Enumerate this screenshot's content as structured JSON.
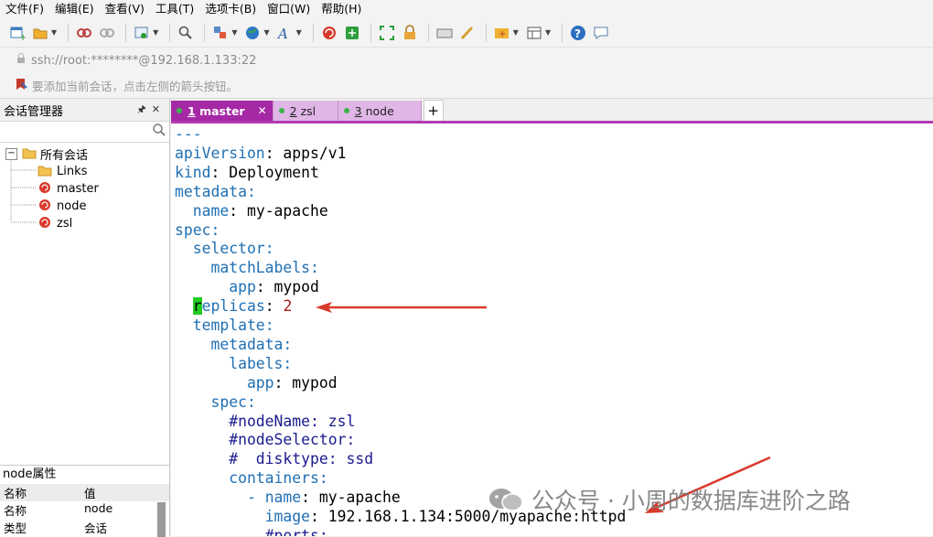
{
  "menu": [
    "文件(F)",
    "编辑(E)",
    "查看(V)",
    "工具(T)",
    "选项卡(B)",
    "窗口(W)",
    "帮助(H)"
  ],
  "address": {
    "text": "ssh://root:********@192.168.1.133:22"
  },
  "hint": {
    "text": "要添加当前会话，点击左侧的箭头按钮。"
  },
  "session_manager": {
    "title": "会话管理器",
    "root": "所有会话",
    "items": [
      "Links",
      "master",
      "node",
      "zsl"
    ]
  },
  "properties": {
    "title": "node属性",
    "headers": [
      "名称",
      "值"
    ],
    "rows": [
      [
        "名称",
        "node"
      ],
      [
        "类型",
        "会话"
      ]
    ]
  },
  "tabs": [
    {
      "num": "1",
      "label": "master",
      "active": true
    },
    {
      "num": "2",
      "label": "zsl",
      "active": false
    },
    {
      "num": "3",
      "label": "node",
      "active": false
    }
  ],
  "terminal": {
    "lines": [
      [
        [
          "---",
          "k"
        ]
      ],
      [
        [
          "apiVersion",
          "k"
        ],
        [
          ": apps/v1",
          "v"
        ]
      ],
      [
        [
          "kind",
          "k"
        ],
        [
          ": Deployment",
          "v"
        ]
      ],
      [
        [
          "metadata",
          "k"
        ],
        [
          ":",
          "k"
        ]
      ],
      [
        [
          "  name",
          "k"
        ],
        [
          ": my-apache",
          "v"
        ]
      ],
      [
        [
          "spec",
          "k"
        ],
        [
          ":",
          "k"
        ]
      ],
      [
        [
          "  selector",
          "k"
        ],
        [
          ":",
          "k"
        ]
      ],
      [
        [
          "    matchLabels",
          "k"
        ],
        [
          ":",
          "k"
        ]
      ],
      [
        [
          "      app",
          "k"
        ],
        [
          ": mypod",
          "v"
        ]
      ],
      [
        [
          "  ",
          "k"
        ],
        [
          "r",
          "cursor"
        ],
        [
          "eplicas",
          "k"
        ],
        [
          ": ",
          "v"
        ],
        [
          "2",
          "n"
        ]
      ],
      [
        [
          "  template",
          "k"
        ],
        [
          ":",
          "k"
        ]
      ],
      [
        [
          "    metadata",
          "k"
        ],
        [
          ":",
          "k"
        ]
      ],
      [
        [
          "      labels",
          "k"
        ],
        [
          ":",
          "k"
        ]
      ],
      [
        [
          "        app",
          "k"
        ],
        [
          ": mypod",
          "v"
        ]
      ],
      [
        [
          "    spec",
          "k"
        ],
        [
          ":",
          "k"
        ]
      ],
      [
        [
          "      #nodeName: zsl",
          "c"
        ]
      ],
      [
        [
          "      #nodeSelector:",
          "c"
        ]
      ],
      [
        [
          "      #  disktype: ssd",
          "c"
        ]
      ],
      [
        [
          "      containers",
          "k"
        ],
        [
          ":",
          "k"
        ]
      ],
      [
        [
          "        - ",
          "k"
        ],
        [
          "name",
          "k"
        ],
        [
          ": my-apache",
          "v"
        ]
      ],
      [
        [
          "          image",
          "k"
        ],
        [
          ": 192.168.1.134:5000/myapache:httpd",
          "v"
        ]
      ],
      [
        [
          "          #ports:",
          "c"
        ]
      ]
    ]
  },
  "watermark": {
    "text": "公众号 · 小周的数据库进阶之路"
  },
  "colors": {
    "tab_active": "#a528a5",
    "tab_inactive": "#e0b6e6",
    "yaml_key": "#1f6fb3",
    "cursor": "#22cc22",
    "arrow": "#d93a2b"
  }
}
